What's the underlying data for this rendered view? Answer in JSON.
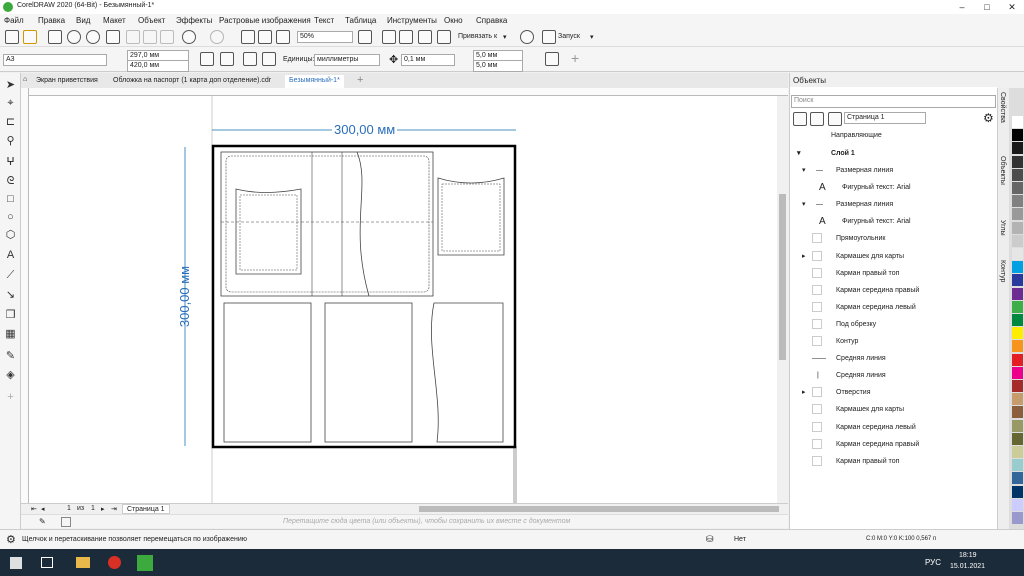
{
  "window": {
    "title": "CorelDRAW 2020 (64-Bit) - Безымянный-1*"
  },
  "menu": [
    "Файл",
    "Правка",
    "Вид",
    "Макет",
    "Объект",
    "Эффекты",
    "Растровые изображения",
    "Текст",
    "Таблица",
    "Инструменты",
    "Окно",
    "Справка"
  ],
  "toolbar": {
    "zoom": "50%",
    "snap": "Привязать к",
    "launch": "Запуск"
  },
  "propbar": {
    "page_size": "A3",
    "width": "297,0 мм",
    "height": "420,0 мм",
    "units_label": "Единицы:",
    "units": "миллиметры",
    "nudge": "0,1 мм",
    "dup_x": "5,0 мм",
    "dup_y": "5,0 мм"
  },
  "tabs": [
    "Экран приветствия",
    "Обложка на паспорт (1 карта доп отделение).cdr",
    "Безымянный-1*"
  ],
  "drawing": {
    "dim_h": "300,00 мм",
    "dim_v": "300,00 мм"
  },
  "docbar": {
    "page": "Страница 1",
    "page_num": "1",
    "of": "из",
    "hint": "Перетащите сюда цвета (или объекты), чтобы сохранить их вместе с документом"
  },
  "status": {
    "hint": "Щелчок и перетаскивание позволяет перемещаться по изображению",
    "fill": "Нет",
    "color_info": "C:0 M:0 Y:0 K:100  0,567 п"
  },
  "panel": {
    "title": "Объекты",
    "search": "Поиск",
    "page": "Страница 1",
    "guides": "Направляющие",
    "layer": "Слой 1",
    "items": [
      "Размерная линия",
      "Фигурный текст: Arial",
      "Размерная линия",
      "Фигурный текст: Arial",
      "Прямоугольник",
      "Кармашек для карты",
      "Карман правый топ",
      "Карман середина правый",
      "Карман середина левый",
      "Под обрезку",
      "Контур",
      "Средняя линия",
      "Средняя линия",
      "Отверстия",
      "Кармашек для карты",
      "Карман середина левый",
      "Карман середина правый",
      "Карман правый топ"
    ]
  },
  "side_tabs": [
    "Свойства",
    "Объекты",
    "Углы",
    "Контур"
  ],
  "palette": [
    "#ffffff",
    "#000000",
    "#1a1a1a",
    "#333333",
    "#4d4d4d",
    "#666666",
    "#808080",
    "#999999",
    "#b3b3b3",
    "#cccccc",
    "#e6e6e6",
    "#00a0e3",
    "#2a3a9c",
    "#6d2c91",
    "#3fae49",
    "#00893e",
    "#ffed00",
    "#f7941d",
    "#e31e24",
    "#ec008c",
    "#a52a2a",
    "#c69c6d",
    "#8b5e3c",
    "#999966",
    "#666633",
    "#cccc99",
    "#99cccc",
    "#336699",
    "#003366",
    "#ccccff",
    "#9999cc"
  ],
  "taskbar": {
    "lang": "РУС",
    "time": "18:19",
    "date": "15.01.2021"
  }
}
